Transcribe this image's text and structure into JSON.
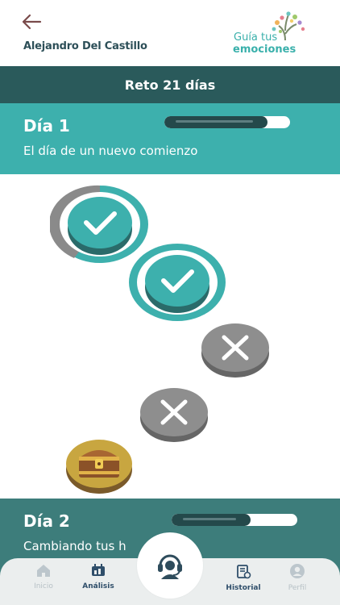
{
  "header": {
    "user_name": "Alejandro Del Castillo",
    "logo_line1": "Guía tus",
    "logo_line2": "emociones"
  },
  "title": "Reto 21 días",
  "days": [
    {
      "title": "Día 1",
      "subtitle": "El día de un nuevo comienzo",
      "progress": 0.82
    },
    {
      "title": "Día 2",
      "subtitle": "Cambiando tus h",
      "progress": 0.63
    }
  ],
  "path_nodes": [
    {
      "status": "completed",
      "icon": "check-icon"
    },
    {
      "status": "completed",
      "icon": "check-icon"
    },
    {
      "status": "failed",
      "icon": "x-icon"
    },
    {
      "status": "failed",
      "icon": "x-icon"
    },
    {
      "status": "reward",
      "icon": "treasure-chest-icon"
    }
  ],
  "nav": [
    {
      "label": "Inicio",
      "icon": "home-icon",
      "state": "inactive"
    },
    {
      "label": "Análisis",
      "icon": "analysis-icon",
      "state": "active"
    },
    {
      "label": "Historial",
      "icon": "history-icon",
      "state": "active"
    },
    {
      "label": "Perfil",
      "icon": "profile-icon",
      "state": "inactive"
    }
  ],
  "center_button_icon": "support-headset-icon",
  "colors": {
    "teal": "#3db0ad",
    "dark_teal": "#2a5a5b",
    "day2_band": "#3d7d7b",
    "failed_gray": "#8e8e8e",
    "nav_bg": "#ebeeee"
  }
}
